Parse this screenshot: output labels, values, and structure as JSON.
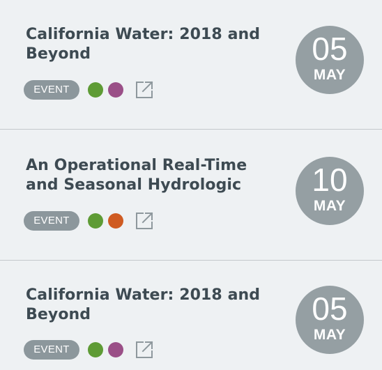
{
  "colors": {
    "green": "#5e9b35",
    "purple": "#9a4f87",
    "orange": "#cf5b22",
    "badge": "#8c979c",
    "date_circle": "#959fa3",
    "title": "#3d4a52"
  },
  "events": [
    {
      "title": "California Water: 2018 and Beyond",
      "tag": "EVENT",
      "dots": [
        "green",
        "purple"
      ],
      "link_icon": "external-link-icon",
      "day": "05",
      "month": "MAY"
    },
    {
      "title": "An Operational Real-Time and Seasonal Hydrologic",
      "tag": "EVENT",
      "dots": [
        "green",
        "orange"
      ],
      "link_icon": "external-link-icon",
      "day": "10",
      "month": "MAY"
    },
    {
      "title": "California Water: 2018 and Beyond",
      "tag": "EVENT",
      "dots": [
        "green",
        "purple"
      ],
      "link_icon": "external-link-icon",
      "day": "05",
      "month": "MAY"
    }
  ]
}
